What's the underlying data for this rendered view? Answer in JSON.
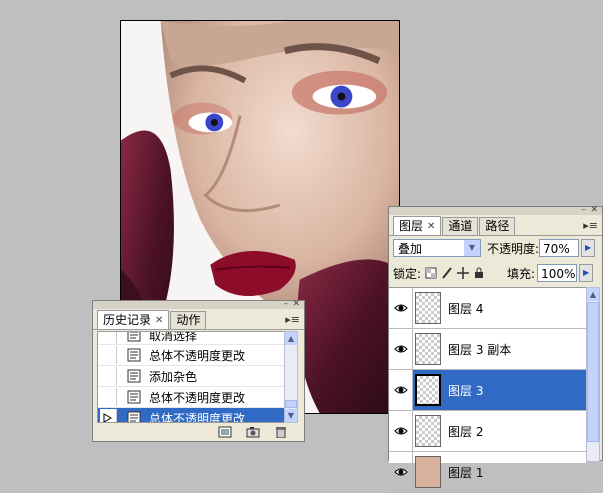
{
  "history_panel": {
    "tabs": [
      {
        "label": "历史记录",
        "active": true
      },
      {
        "label": "动作",
        "active": false
      }
    ],
    "items": [
      {
        "label": "取消选择",
        "selected": false
      },
      {
        "label": "总体不透明度更改",
        "selected": false
      },
      {
        "label": "添加杂色",
        "selected": false
      },
      {
        "label": "总体不透明度更改",
        "selected": false
      },
      {
        "label": "总体不透明度更改",
        "selected": true
      }
    ],
    "footer_icons": [
      "new-document-from-state-icon",
      "new-snapshot-icon",
      "delete-icon"
    ]
  },
  "layers_panel": {
    "tabs": [
      {
        "label": "图层",
        "active": true
      },
      {
        "label": "通道",
        "active": false
      },
      {
        "label": "路径",
        "active": false
      }
    ],
    "blend_mode": "叠加",
    "opacity_label": "不透明度:",
    "opacity_value": "70%",
    "lock_label": "锁定:",
    "fill_label": "填充:",
    "fill_value": "100%",
    "layers": [
      {
        "name": "图层 4",
        "selected": false,
        "thumb": "transparent"
      },
      {
        "name": "图层 3 副本",
        "selected": false,
        "thumb": "transparent"
      },
      {
        "name": "图层 3",
        "selected": true,
        "thumb": "transparent"
      },
      {
        "name": "图层 2",
        "selected": false,
        "thumb": "transparent"
      },
      {
        "name": "图层 1",
        "selected": false,
        "thumb": "photo"
      }
    ]
  },
  "colors": {
    "selection": "#316ac5",
    "panel_bg": "#ece9d8",
    "workspace": "#bfbfbf"
  }
}
